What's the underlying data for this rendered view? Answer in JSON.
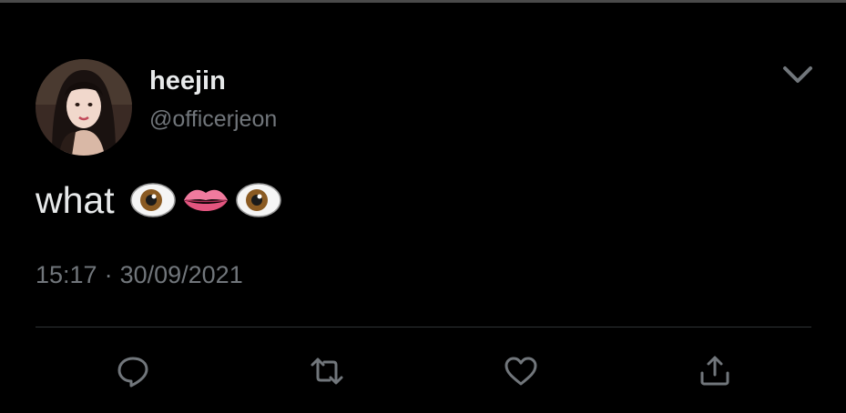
{
  "tweet": {
    "author": {
      "display_name": "heejin",
      "handle": "@officerjeon"
    },
    "text": "what",
    "emojis": [
      "eye-emoji",
      "lips-emoji",
      "eye-emoji"
    ],
    "time": "15:17",
    "separator": "·",
    "date": "30/09/2021"
  },
  "actions": [
    "reply-icon",
    "retweet-icon",
    "like-icon",
    "share-icon"
  ],
  "colors": {
    "background": "#000000",
    "primary_text": "#e7e9ea",
    "secondary_text": "#71767b",
    "divider": "#2f3336"
  }
}
